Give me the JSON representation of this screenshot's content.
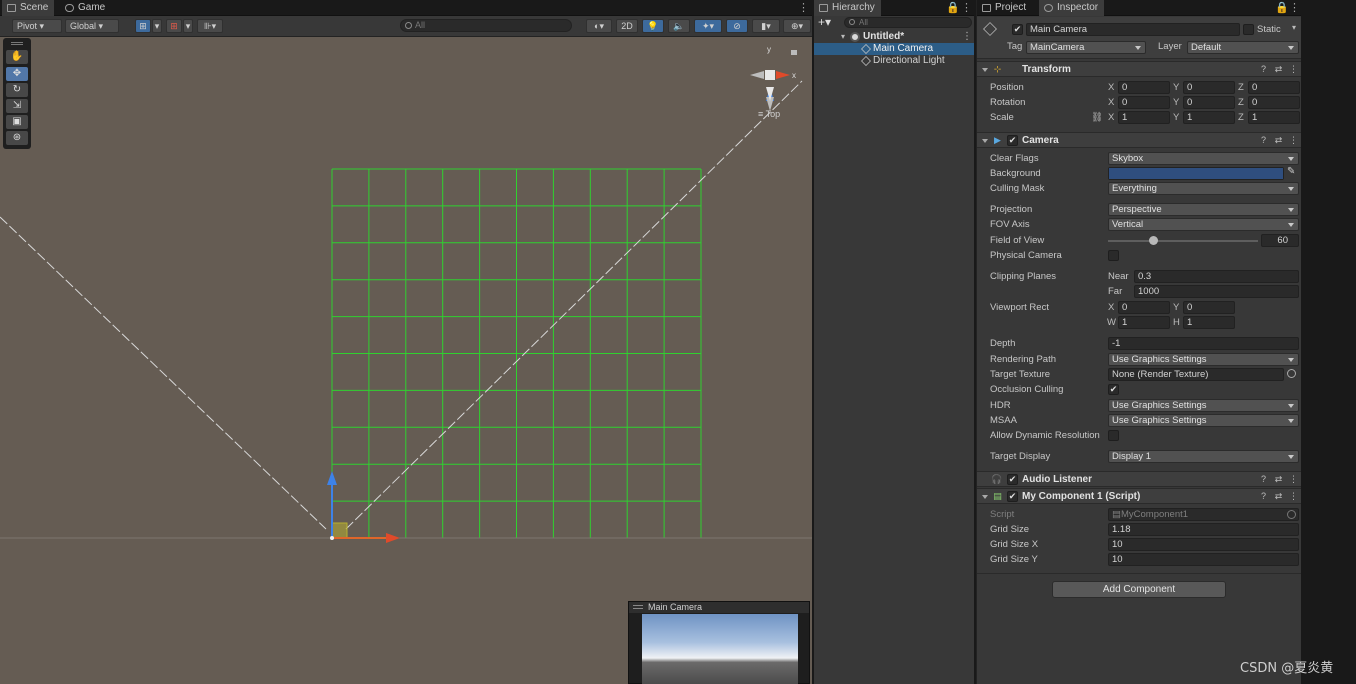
{
  "scene_tabs": [
    "Scene",
    "Game"
  ],
  "scene_toolbar": {
    "pivot": "Pivot",
    "global": "Global",
    "search_placeholder": "All",
    "btn_2d": "2D"
  },
  "gizmo": {
    "x": "x",
    "y": "y",
    "view": "Top"
  },
  "camera_preview": {
    "title": "Main Camera"
  },
  "hierarchy": {
    "tab": "Hierarchy",
    "search_placeholder": "All",
    "scene": "Untitled*",
    "items": [
      "Main Camera",
      "Directional Light"
    ]
  },
  "inspector": {
    "tabs": [
      "Project",
      "Inspector"
    ],
    "object_name": "Main Camera",
    "static_label": "Static",
    "tag_label": "Tag",
    "tag_value": "MainCamera",
    "layer_label": "Layer",
    "layer_value": "Default",
    "transform": {
      "title": "Transform",
      "rows": [
        {
          "label": "Position",
          "x": "0",
          "y": "0",
          "z": "0"
        },
        {
          "label": "Rotation",
          "x": "0",
          "y": "0",
          "z": "0"
        },
        {
          "label": "Scale",
          "x": "1",
          "y": "1",
          "z": "1"
        }
      ]
    },
    "camera": {
      "title": "Camera",
      "clear_flags": {
        "label": "Clear Flags",
        "value": "Skybox"
      },
      "background": {
        "label": "Background",
        "color": "#2f4e7e"
      },
      "culling_mask": {
        "label": "Culling Mask",
        "value": "Everything"
      },
      "projection": {
        "label": "Projection",
        "value": "Perspective"
      },
      "fov_axis": {
        "label": "FOV Axis",
        "value": "Vertical"
      },
      "field_of_view": {
        "label": "Field of View",
        "value": "60",
        "fraction": 0.3
      },
      "physical_camera": {
        "label": "Physical Camera"
      },
      "clipping": {
        "label": "Clipping Planes",
        "near_label": "Near",
        "near": "0.3",
        "far_label": "Far",
        "far": "1000"
      },
      "viewport": {
        "label": "Viewport Rect",
        "x": "0",
        "y": "0",
        "w": "1",
        "h": "1"
      },
      "depth": {
        "label": "Depth",
        "value": "-1"
      },
      "rendering_path": {
        "label": "Rendering Path",
        "value": "Use Graphics Settings"
      },
      "target_texture": {
        "label": "Target Texture",
        "value": "None (Render Texture)"
      },
      "occlusion": {
        "label": "Occlusion Culling",
        "check": "✔"
      },
      "hdr": {
        "label": "HDR",
        "value": "Use Graphics Settings"
      },
      "msaa": {
        "label": "MSAA",
        "value": "Use Graphics Settings"
      },
      "dynamic_res": {
        "label": "Allow Dynamic Resolution"
      },
      "target_display": {
        "label": "Target Display",
        "value": "Display 1"
      }
    },
    "audio_listener": {
      "title": "Audio Listener"
    },
    "my_component": {
      "title": "My Component 1 (Script)",
      "script_label": "Script",
      "script_value": "MyComponent1",
      "grid_size_label": "Grid Size",
      "grid_size": "1.18",
      "grid_x_label": "Grid Size X",
      "grid_x": "10",
      "grid_y_label": "Grid Size Y",
      "grid_y": "10"
    },
    "add_component": "Add Component"
  },
  "watermark": "CSDN @夏炎黄"
}
